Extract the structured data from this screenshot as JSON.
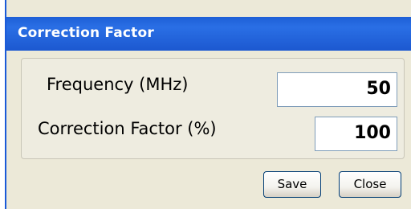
{
  "window": {
    "title": "Correction Factor"
  },
  "form": {
    "frequency_label": "Frequency (MHz)",
    "frequency_value": "50",
    "correction_label": "Correction Factor (%)",
    "correction_value": "100"
  },
  "buttons": {
    "save_label": "Save",
    "close_label": "Close"
  },
  "colors": {
    "titlebar": "#1e5fd6",
    "dialog_background": "#ece9d8",
    "button_border": "#003c74"
  }
}
